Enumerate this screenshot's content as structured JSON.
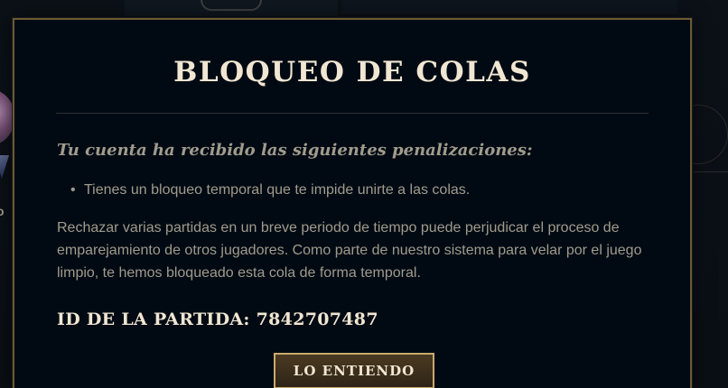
{
  "background": {
    "partial_letter": "o"
  },
  "modal": {
    "title": "BLOQUEO DE COLAS",
    "subtitle": "Tu cuenta ha recibido las siguientes penalizaciones:",
    "penalties": [
      "Tienes un bloqueo temporal que te impide unirte a las colas."
    ],
    "body": "Rechazar varias partidas en un breve periodo de tiempo puede perjudicar el proceso de emparejamiento de otros jugadores. Como parte de nuestro sistema para velar por el juego limpio, te hemos bloqueado esta cola de forma temporal.",
    "game_id": "ID DE LA PARTIDA: 7842707487",
    "button_label": "LO ENTIENDO"
  },
  "colors": {
    "gold_border": "#c8aa6e",
    "title_text": "#f0e6d2",
    "body_text": "#a09b8c",
    "modal_bg": "#010a13"
  }
}
